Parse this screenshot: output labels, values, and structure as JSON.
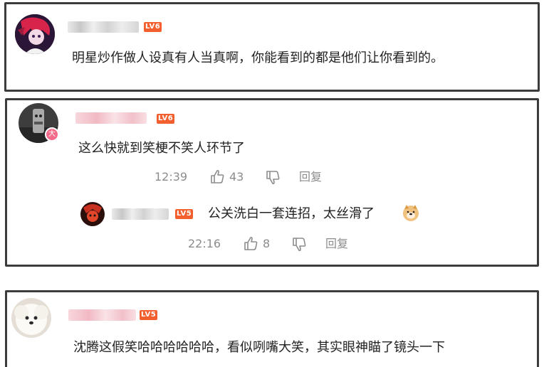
{
  "comments": [
    {
      "level_badge": "LV6",
      "text": "明星炒作做人设真有人当真啊，你能看到的都是他们让你看到的。"
    },
    {
      "level_badge": "LV6",
      "avatar_badge": "大",
      "text": "这么快就到笑梗不笑人环节了",
      "time": "12:39",
      "likes": "43",
      "reply_label": "回复",
      "reply": {
        "level_badge": "LV5",
        "text": "公关洗白一套连招，太丝滑了",
        "time": "22:16",
        "likes": "8",
        "reply_label": "回复"
      }
    },
    {
      "level_badge": "LV5",
      "text": "沈腾这假笑哈哈哈哈哈哈，看似咧嘴大笑，其实眼神瞄了镜头一下"
    }
  ],
  "colors": {
    "border": "#3c3c3c",
    "level_badge": "#f35f2f",
    "meta_text": "#8c8c8c",
    "body_text": "#222222"
  }
}
